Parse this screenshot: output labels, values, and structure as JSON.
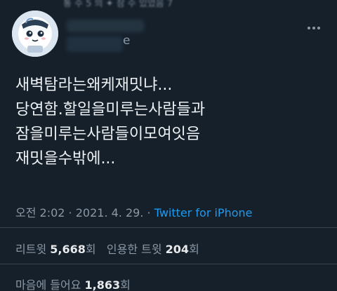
{
  "top": {
    "blurred_text": "통 수 5 의 ✦ 잠 수 있었음 7"
  },
  "author": {
    "handle_tail": "e"
  },
  "tweet": {
    "lines": [
      "새벽탐라는왜케재밋냐...",
      "당연함.할일을미루는사람들과",
      "잠을미루는사람들이모여잇음",
      "재밋을수밖에..."
    ]
  },
  "meta": {
    "time": "오전 2:02",
    "sep1": " · ",
    "date": "2021. 4. 29.",
    "sep2": " · ",
    "source": "Twitter for iPhone"
  },
  "stats": {
    "retweets_label": "리트윗",
    "retweets_count": "5,668",
    "retweets_unit": "회",
    "quotes_label": "인용한 트윗",
    "quotes_count": "204",
    "quotes_unit": "회",
    "likes_label": "마음에 들어요",
    "likes_count": "1,863",
    "likes_unit": "회"
  },
  "icons": {
    "more": "more-dots-icon",
    "avatar": "avatar-image"
  },
  "colors": {
    "background": "#15202b",
    "link": "#1d9bf0",
    "muted": "#8b98a5",
    "divider": "#38444d"
  }
}
